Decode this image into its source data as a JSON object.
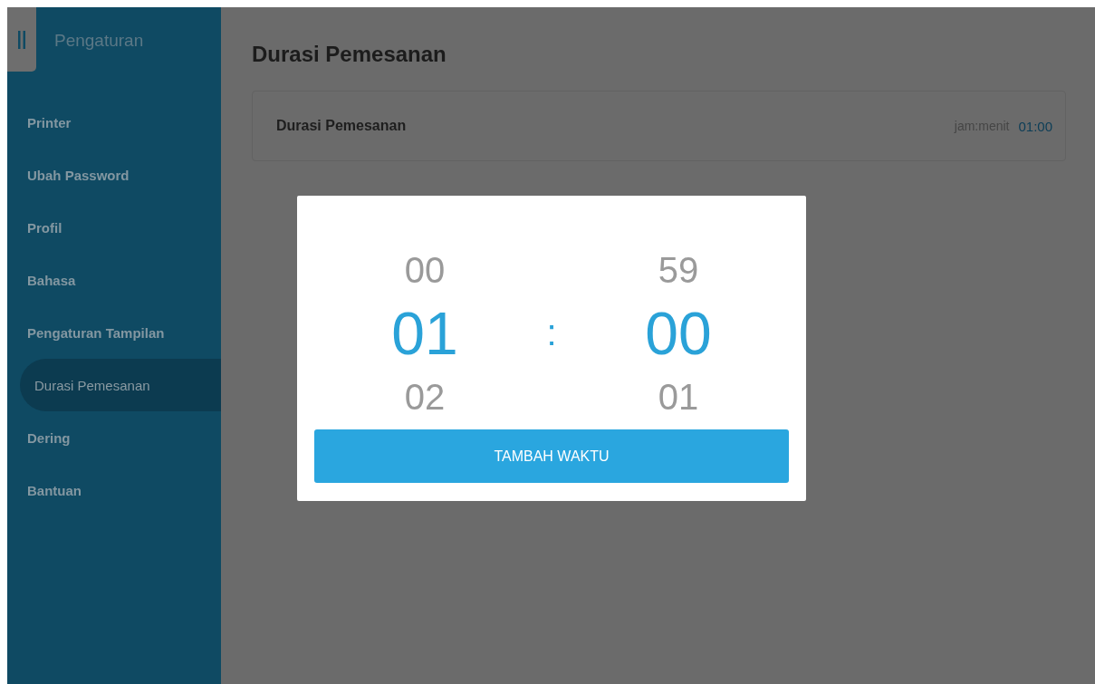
{
  "sidebar": {
    "title": "Pengaturan",
    "items": [
      {
        "label": "Printer",
        "selected": false
      },
      {
        "label": "Ubah Password",
        "selected": false
      },
      {
        "label": "Profil",
        "selected": false
      },
      {
        "label": "Bahasa",
        "selected": false
      },
      {
        "label": "Pengaturan Tampilan",
        "selected": false
      },
      {
        "label": "Durasi Pemesanan",
        "selected": true
      },
      {
        "label": "Dering",
        "selected": false
      },
      {
        "label": "Bantuan",
        "selected": false
      }
    ]
  },
  "page": {
    "title": "Durasi Pemesanan",
    "setting": {
      "label": "Durasi Pemesanan",
      "unit": "jam:menit",
      "value": "01:00"
    }
  },
  "dialog": {
    "columns": [
      {
        "values": [
          {
            "text": "00",
            "selected": false
          },
          {
            "text": "01",
            "selected": true
          },
          {
            "text": "02",
            "selected": false
          }
        ]
      },
      {
        "values": [
          {
            "text": "59",
            "selected": false
          },
          {
            "text": "00",
            "selected": true
          },
          {
            "text": "01",
            "selected": false
          }
        ]
      }
    ],
    "separator": ":",
    "button": "TAMBAH WAKTU"
  }
}
